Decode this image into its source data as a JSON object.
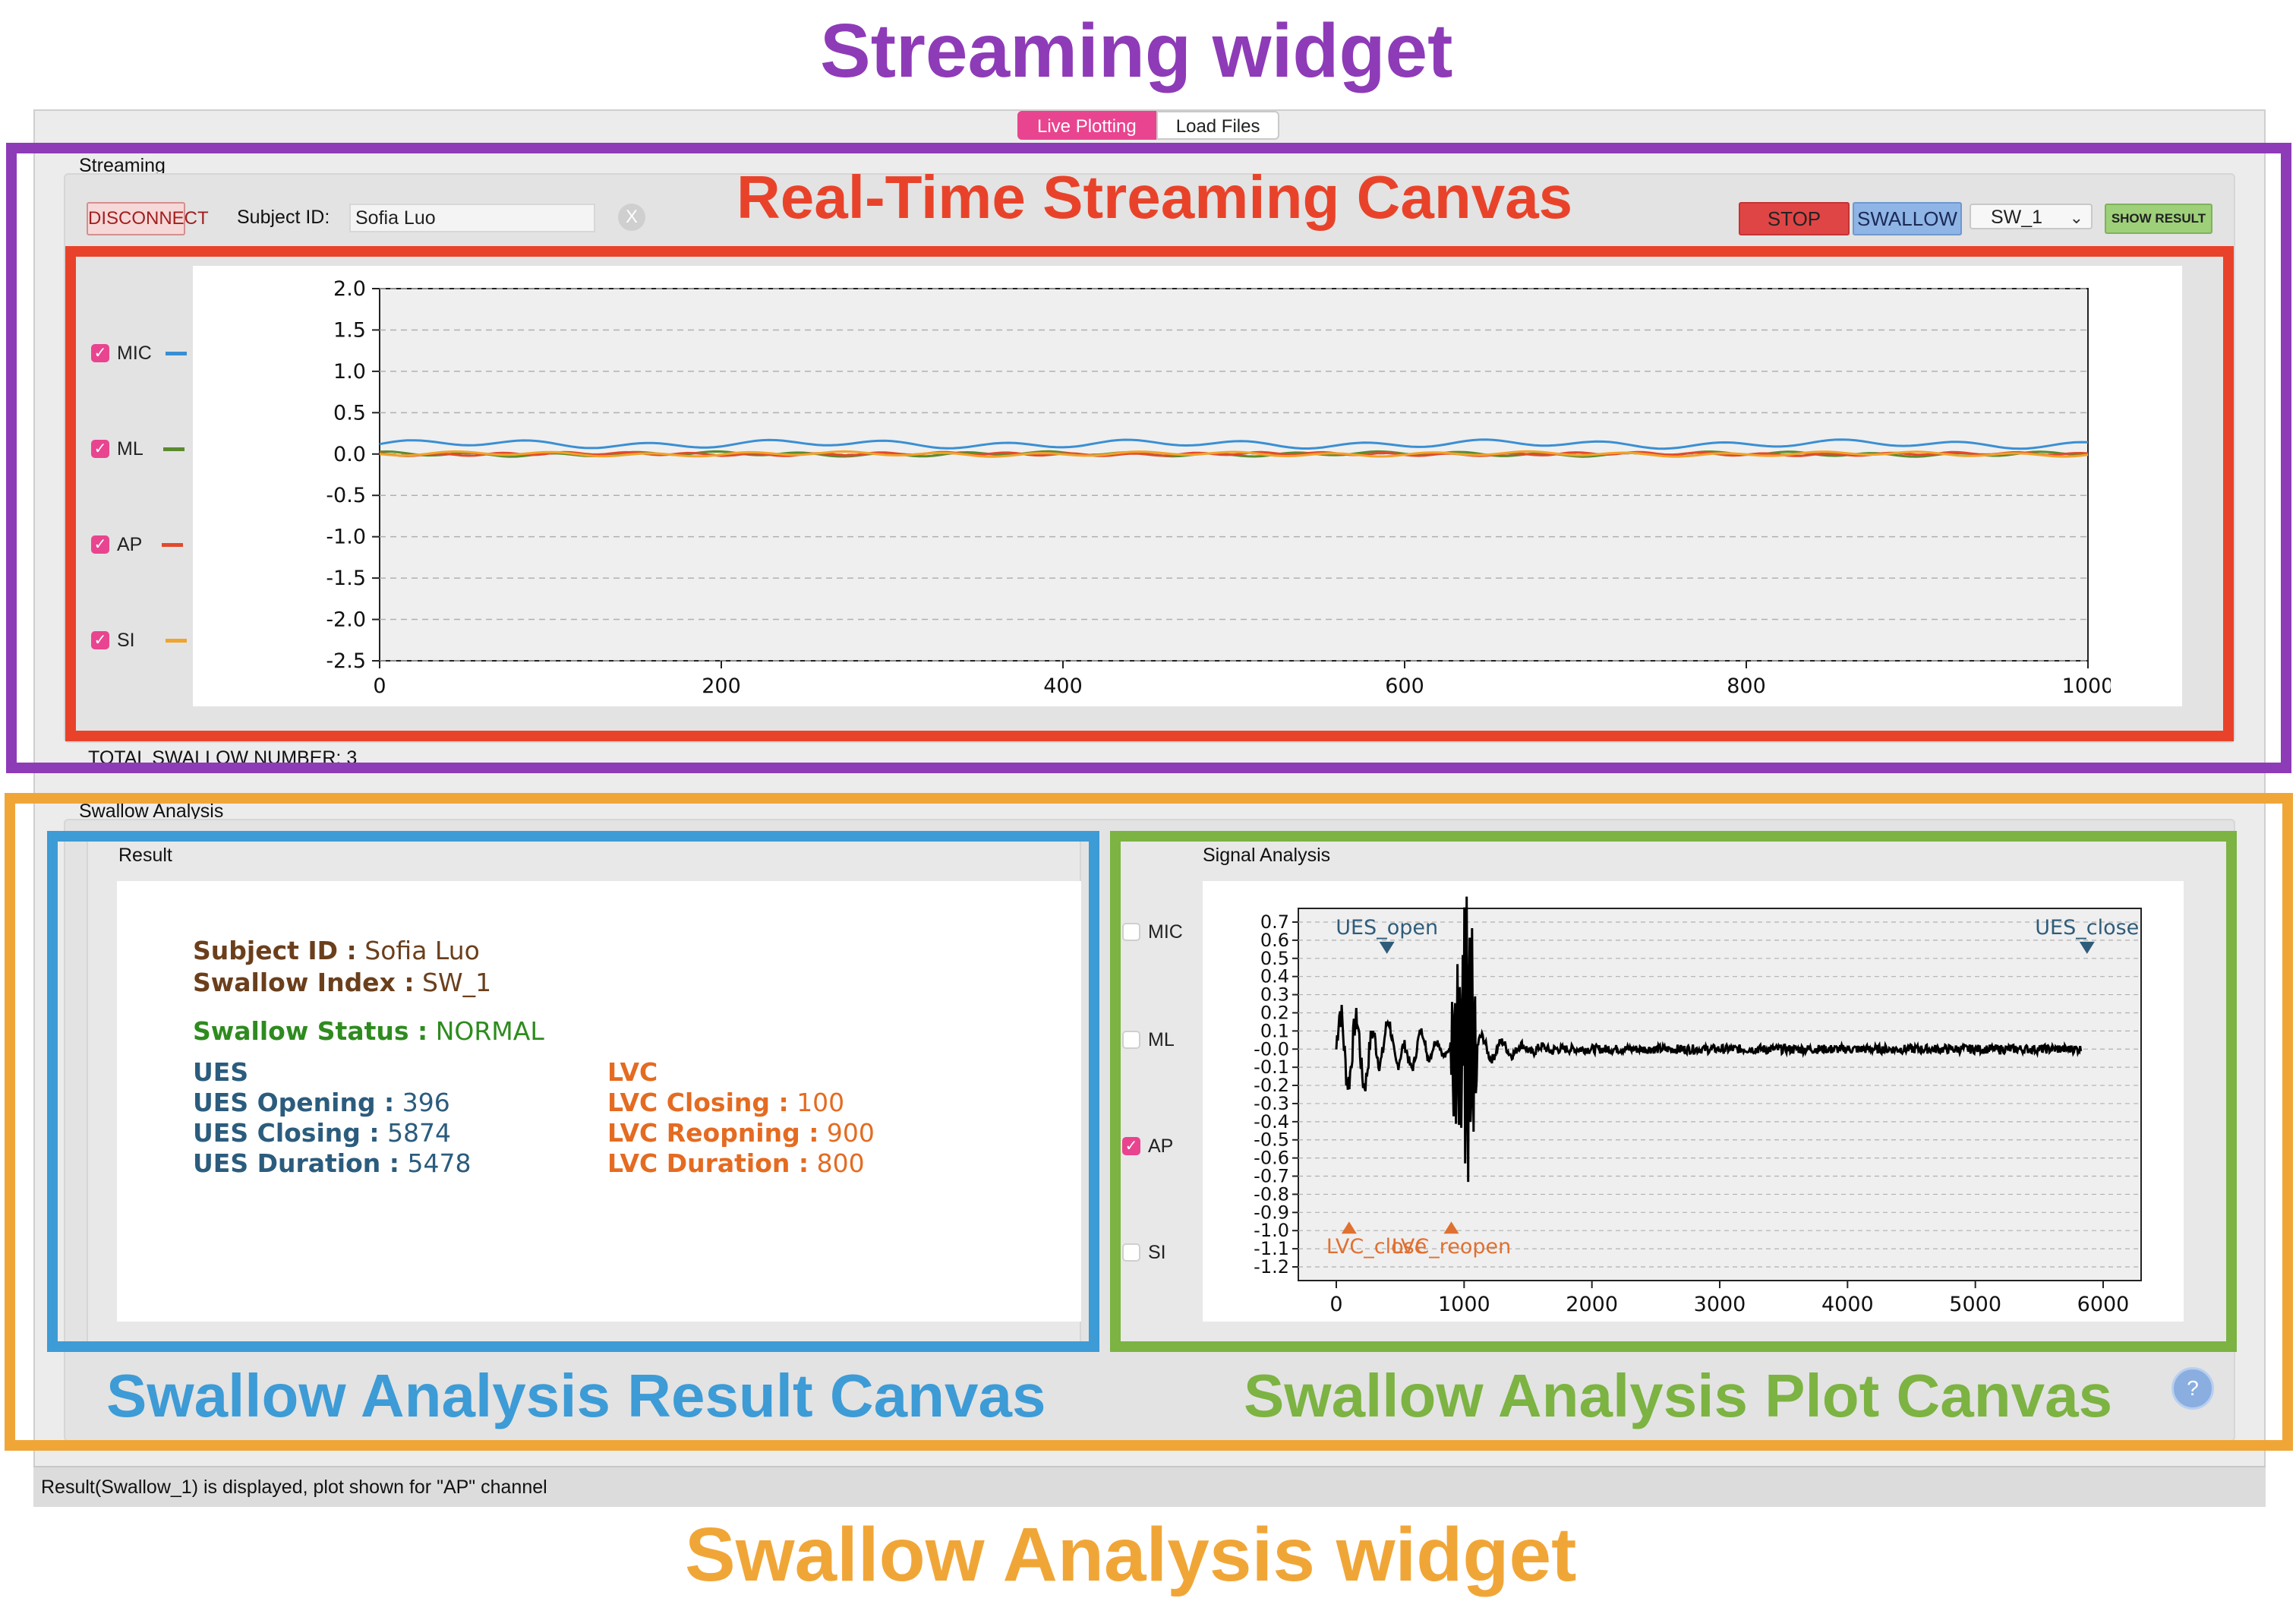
{
  "titles": {
    "streaming_widget": "Streaming widget",
    "realtime_canvas": "Real-Time Streaming Canvas",
    "result_canvas": "Swallow Analysis Result Canvas",
    "plot_canvas": "Swallow Analysis Plot Canvas",
    "analysis_widget": "Swallow Analysis widget"
  },
  "colors": {
    "purple": "#8e3bb8",
    "red": "#e8432a",
    "orange": "#f0a637",
    "blue": "#3d9bd6",
    "green": "#7cb342",
    "tab_active": "#e9448f"
  },
  "tabs": [
    {
      "label": "Live Plotting",
      "active": true
    },
    {
      "label": "Load Files",
      "active": false
    }
  ],
  "streaming": {
    "group_title": "Streaming",
    "disconnect_label": "DISCONNECT",
    "subject_label": "Subject ID:",
    "subject_value": "Sofia Luo",
    "clear_icon": "x-circle-icon",
    "clear_label": "X",
    "stop_label": "STOP",
    "swallow_label": "SWALLOW",
    "select_value": "SW_1",
    "show_result_label": "SHOW RESULT",
    "total_label": "TOTAL SWALLOW NUMBER: 3",
    "channels": [
      {
        "name": "MIC",
        "checked": true,
        "color": "#3a8fd3"
      },
      {
        "name": "ML",
        "checked": true,
        "color": "#5b8a2e"
      },
      {
        "name": "AP",
        "checked": true,
        "color": "#e24a2c"
      },
      {
        "name": "SI",
        "checked": true,
        "color": "#f0a42b"
      }
    ]
  },
  "analysis": {
    "group_title": "Swallow Analysis",
    "result_title": "Result",
    "signal_title": "Signal Analysis",
    "help_icon": "help-icon",
    "help_label": "?",
    "result": {
      "subject_label": "Subject ID :",
      "subject_value": "Sofia Luo",
      "index_label": "Swallow Index :",
      "index_value": "SW_1",
      "status_label": "Swallow Status :",
      "status_value": "NORMAL",
      "ues_header": "UES",
      "ues_opening_label": "UES Opening :",
      "ues_opening_value": "396",
      "ues_closing_label": "UES Closing :",
      "ues_closing_value": "5874",
      "ues_duration_label": "UES Duration :",
      "ues_duration_value": "5478",
      "lvc_header": "LVC",
      "lvc_closing_label": "LVC Closing :",
      "lvc_closing_value": "100",
      "lvc_reopening_label": "LVC Reopning :",
      "lvc_reopening_value": "900",
      "lvc_duration_label": "LVC Duration :",
      "lvc_duration_value": "800"
    },
    "channels": [
      {
        "name": "MIC",
        "checked": false
      },
      {
        "name": "ML",
        "checked": false
      },
      {
        "name": "AP",
        "checked": true
      },
      {
        "name": "SI",
        "checked": false
      }
    ]
  },
  "status_bar": "Result(Swallow_1) is displayed, plot shown for \"AP\" channel",
  "chart_data": [
    {
      "type": "line",
      "xlim": [
        0,
        1000
      ],
      "ylim": [
        -2.5,
        2.0
      ],
      "x_ticks": [
        0,
        200,
        400,
        600,
        800,
        1000
      ],
      "y_ticks": [
        2.0,
        1.5,
        1.0,
        0.5,
        0.0,
        -0.5,
        -1.0,
        -1.5,
        -2.0,
        -2.5
      ],
      "grid": true,
      "series": [
        {
          "name": "MIC",
          "level": 0.12,
          "color": "#3a8fd3"
        },
        {
          "name": "ML",
          "level": 0.0,
          "color": "#5b8a2e"
        },
        {
          "name": "AP",
          "level": 0.0,
          "color": "#e24a2c"
        },
        {
          "name": "SI",
          "level": 0.0,
          "color": "#f0a42b"
        }
      ]
    },
    {
      "type": "line",
      "xlim": [
        0,
        6000
      ],
      "ylim": [
        -1.2,
        0.7
      ],
      "x_ticks": [
        0,
        1000,
        2000,
        3000,
        4000,
        5000,
        6000
      ],
      "y_ticks": [
        0.7,
        0.6,
        0.5,
        0.4,
        0.3,
        0.2,
        0.1,
        -0.0,
        -0.1,
        -0.2,
        -0.3,
        -0.4,
        -0.5,
        -0.6,
        -0.7,
        -0.8,
        -0.9,
        -1.0,
        -1.1,
        -1.2
      ],
      "grid": true,
      "series": [
        {
          "name": "AP",
          "color": "#000000"
        }
      ],
      "annotations": [
        {
          "label": "UES_open",
          "x": 396,
          "y": 0.55,
          "marker": "down",
          "color": "#2f5c7a"
        },
        {
          "label": "UES_close",
          "x": 5874,
          "y": 0.55,
          "marker": "down",
          "color": "#2f5c7a"
        },
        {
          "label": "LVC_close",
          "x": 100,
          "y": -1.0,
          "marker": "up",
          "color": "#e07030"
        },
        {
          "label": "LVC_reopen",
          "x": 900,
          "y": -1.0,
          "marker": "up",
          "color": "#e07030"
        }
      ]
    }
  ]
}
